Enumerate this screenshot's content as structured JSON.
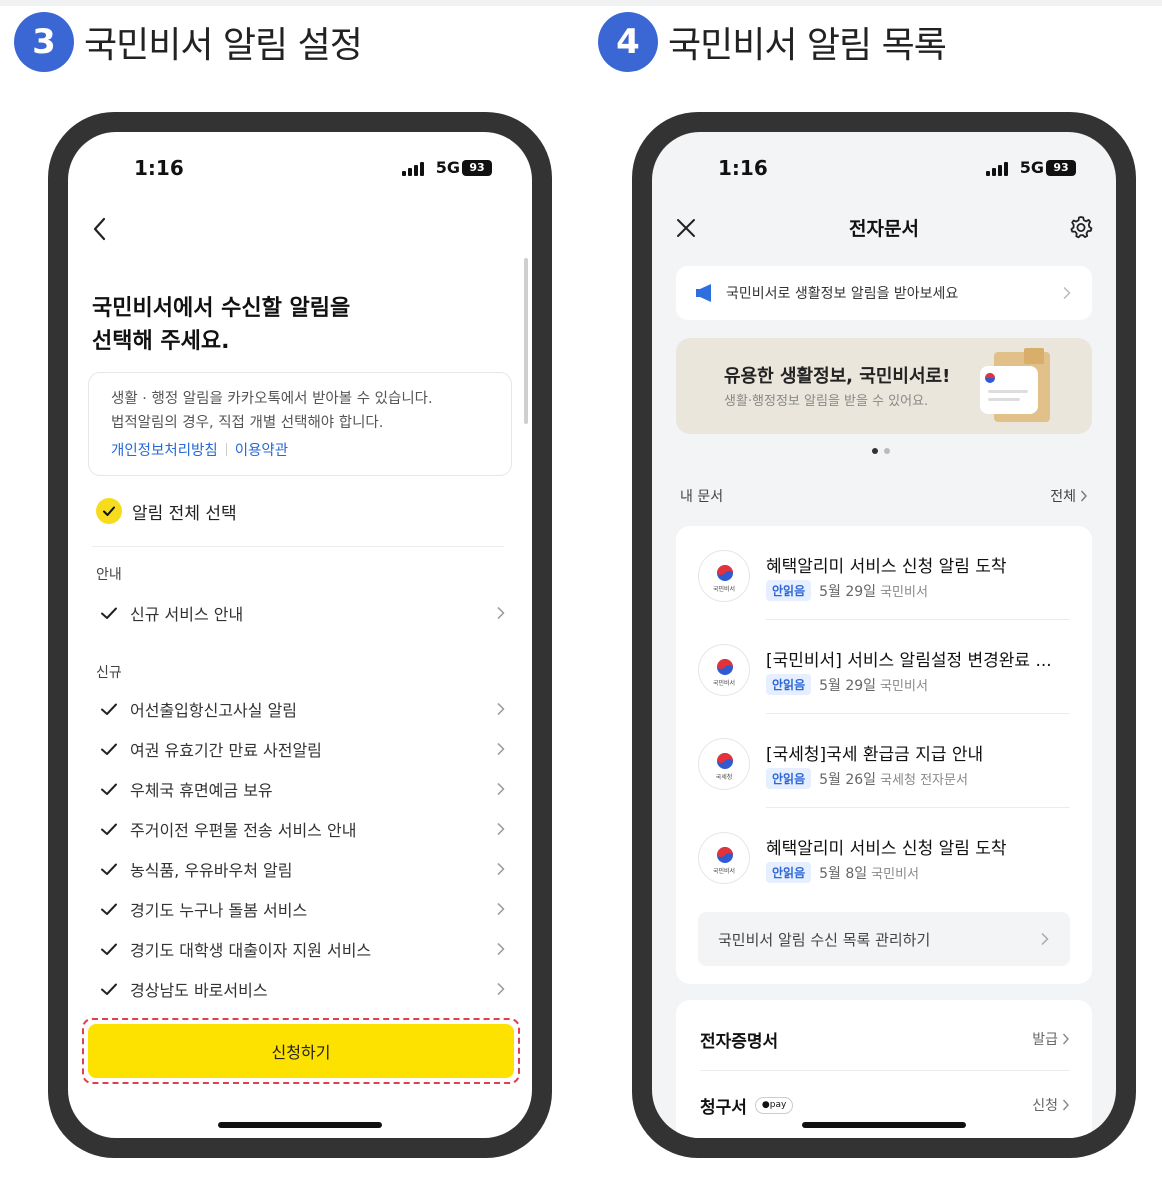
{
  "steps": [
    {
      "num": "3",
      "title": "국민비서 알림 설정"
    },
    {
      "num": "4",
      "title": "국민비서 알림 목록"
    }
  ],
  "status": {
    "time": "1:16",
    "network": "5G",
    "battery": "93"
  },
  "settings": {
    "heading_line1": "국민비서에서 수신할 알림을",
    "heading_line2": "선택해 주세요.",
    "info_line1": "생활 · 행정 알림을 카카오톡에서 받아볼 수 있습니다.",
    "info_line2": "법적알림의 경우, 직접 개별 선택해야 합니다.",
    "privacy_link": "개인정보처리방침",
    "terms_link": "이용약관",
    "select_all": "알림 전체 선택",
    "section_guide": "안내",
    "guide_items": [
      "신규 서비스 안내"
    ],
    "section_new": "신규",
    "new_items": [
      "어선출입항신고사실 알림",
      "여권 유효기간 만료 사전알림",
      "우체국 휴면예금 보유",
      "주거이전 우편물 전송 서비스 안내",
      "농식품, 우유바우처 알림",
      "경기도 누구나 돌봄 서비스",
      "경기도 대학생 대출이자 지원 서비스",
      "경상남도 바로서비스"
    ],
    "submit_label": "신청하기"
  },
  "docs": {
    "page_title": "전자문서",
    "notice_text": "국민비서로 생활정보 알림을 받아보세요",
    "banner_title": "유용한 생활정보, 국민비서로!",
    "banner_sub": "생활·행정정보 알림을 받을 수 있어요.",
    "my_docs_label": "내 문서",
    "all_label": "전체",
    "items": [
      {
        "title": "혜택알리미 서비스 신청 알림 도착",
        "badge": "안읽음",
        "date": "5월 29일",
        "from": "국민비서",
        "org": "국민비서"
      },
      {
        "title": "[국민비서] 서비스 알림설정 변경완료 ...",
        "badge": "안읽음",
        "date": "5월 29일",
        "from": "국민비서",
        "org": "국민비서"
      },
      {
        "title": "[국세청]국세 환급금 지급 안내",
        "badge": "안읽음",
        "date": "5월 26일",
        "from": "국세청 전자문서",
        "org": "국세청"
      },
      {
        "title": "혜택알리미 서비스 신청 알림 도착",
        "badge": "안읽음",
        "date": "5월 8일",
        "from": "국민비서",
        "org": "국민비서"
      }
    ],
    "manage_label": "국민비서 알림 수신 목록 관리하기",
    "cert_label": "전자증명서",
    "cert_action": "발급",
    "bill_label": "청구서",
    "bill_badge": "●pay",
    "bill_action": "신청"
  },
  "colors": {
    "accent_yellow": "#fde200",
    "step_blue": "#3a67d4",
    "link_blue": "#2868d8",
    "highlight_red": "#e0404a"
  }
}
